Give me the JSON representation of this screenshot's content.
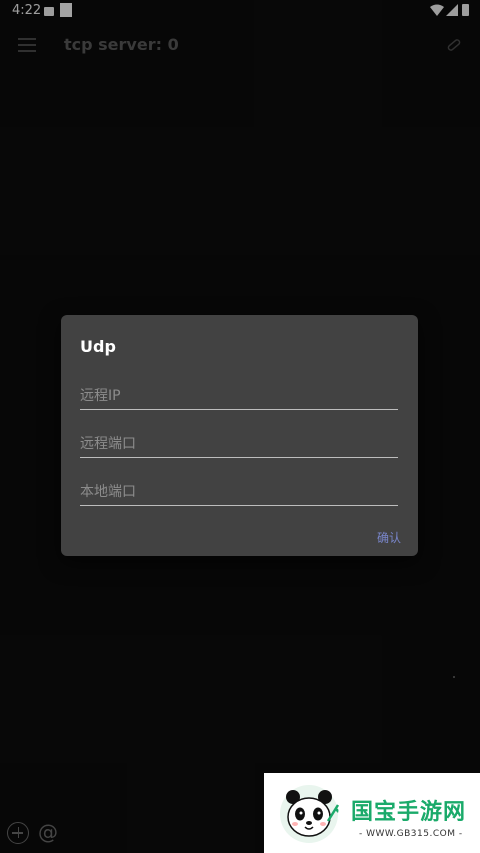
{
  "status_bar": {
    "time": "4:22"
  },
  "toolbar": {
    "title": "tcp server: 0"
  },
  "dialog": {
    "title": "Udp",
    "fields": [
      {
        "placeholder": "远程IP",
        "value": ""
      },
      {
        "placeholder": "远程端口",
        "value": ""
      },
      {
        "placeholder": "本地端口",
        "value": ""
      }
    ],
    "confirm_label": "确认"
  },
  "bottom_bar": {
    "at_label": "@"
  },
  "watermark": {
    "brand": "国宝手游网",
    "url": "- WWW.GB315.COM -"
  },
  "colors": {
    "background": "#0c0c0c",
    "dialog": "#424242",
    "accent": "#7986cb",
    "watermark_green": "#1aaa6a"
  }
}
